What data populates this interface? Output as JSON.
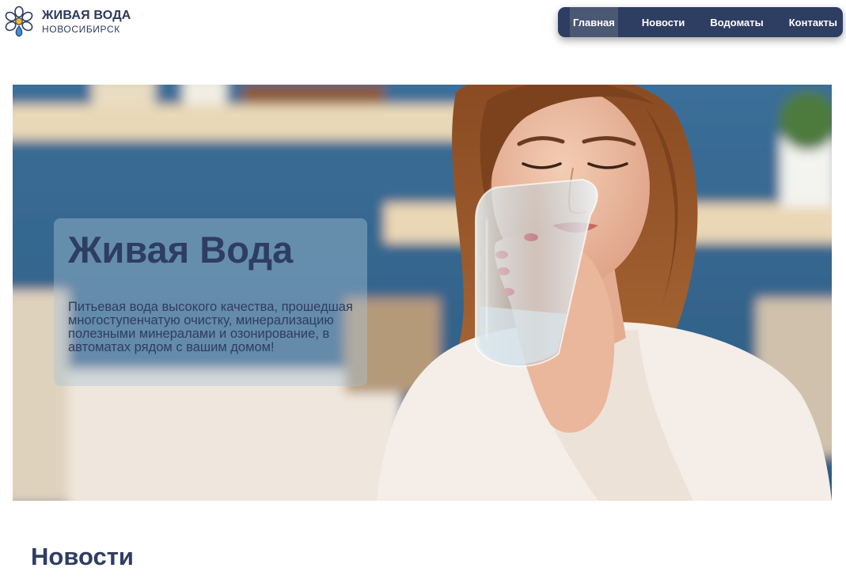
{
  "brand": {
    "title": "ЖИВАЯ ВОДА",
    "subtitle": "НОВОСИБИРСК"
  },
  "nav": {
    "items": [
      {
        "label": "Главная",
        "active": true
      },
      {
        "label": "Новости",
        "active": false
      },
      {
        "label": "Водоматы",
        "active": false
      },
      {
        "label": "Контакты",
        "active": false
      }
    ]
  },
  "hero": {
    "title": "Живая Вода",
    "text": "Питьевая вода высокого качества, прошедшая многоступенчатую очистку, минерализацию полезными минералами и озонирование, в автоматах рядом с вашим домом!"
  },
  "news": {
    "title": "Новости"
  },
  "colors": {
    "primary": "#2e3d62",
    "nav_active": "#4b5873",
    "logo_blue": "#3a8fd6",
    "logo_yellow": "#f2b81f"
  }
}
